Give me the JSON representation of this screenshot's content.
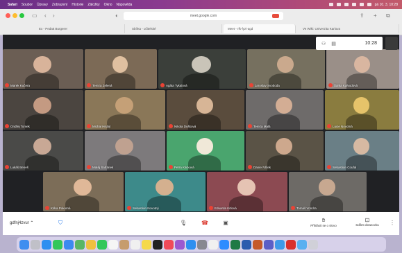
{
  "menubar": {
    "apple": "",
    "items": [
      "Safari",
      "Soubor",
      "Úpravy",
      "Zobrazení",
      "Historie",
      "Záložky",
      "Okno",
      "Nápověda"
    ],
    "clock": "pá 10. 3. 10:28"
  },
  "browser": {
    "url": "meet.google.com",
    "tabs": [
      {
        "label": "Ex - Pedatt Burgerer"
      },
      {
        "label": "Sbírka - učitelské"
      },
      {
        "label": "Meet - rfk-fyzi-agd"
      },
      {
        "label": "Ve Wiki: Univerzita Karlova"
      }
    ]
  },
  "meet": {
    "time": "10:28",
    "participant_icon": "people-icon",
    "chat_icon": "chat-icon",
    "participants": [
      {
        "name": "Marek Kučera",
        "colors": [
          "#6b5e54",
          "#d8b39a"
        ]
      },
      {
        "name": "Tereza Zelená",
        "colors": [
          "#7c6a56",
          "#e0c0a0"
        ]
      },
      {
        "name": "Agáta Tykalová",
        "colors": [
          "#3b3f3a",
          "#c9c4b8"
        ]
      },
      {
        "name": "Jaroslav Svoboda",
        "colors": [
          "#76705f",
          "#caa98d"
        ]
      },
      {
        "name": "Šárka Kalvodová",
        "colors": [
          "#9a8f88",
          "#d9b6a0"
        ]
      },
      {
        "name": "Ondřej Tomek",
        "colors": [
          "#4b4540",
          "#c49a82"
        ]
      },
      {
        "name": "Michal Hrubý",
        "colors": [
          "#8a7758",
          "#c5a077"
        ]
      },
      {
        "name": "Nikola Dušková",
        "colors": [
          "#5a4c3d",
          "#d7b596"
        ]
      },
      {
        "name": "Tereza Malá",
        "colors": [
          "#6e6b6a",
          "#d3ad94"
        ]
      },
      {
        "name": "Lucie Novotná",
        "colors": [
          "#8a7c3f",
          "#e6c36a"
        ]
      },
      {
        "name": "Lukáš Beneš",
        "colors": [
          "#4a4a48",
          "#c8a895"
        ]
      },
      {
        "name": "Matěj Šafránek",
        "colors": [
          "#7d7a7c",
          "#bfa190"
        ]
      },
      {
        "name": "Petra Klicková",
        "colors": [
          "#4aa56e",
          "#f0e8d8"
        ]
      },
      {
        "name": "Daniel Vlček",
        "colors": [
          "#5a5346",
          "#cda88d"
        ]
      },
      {
        "name": "Sebastián Coufal",
        "colors": [
          "#6a7f86",
          "#d6b9a2"
        ]
      },
      {
        "name": "Klára Pokorná",
        "colors": [
          "#7c6d58",
          "#e0b898"
        ]
      },
      {
        "name": "Sebastián Novotný",
        "colors": [
          "#3d8a8a",
          "#d4b08f"
        ]
      },
      {
        "name": "Eduarda Kitlová",
        "colors": [
          "#8c4a52",
          "#e5c3b3"
        ]
      },
      {
        "name": "Tomáš Vondra",
        "colors": [
          "#6d6a66",
          "#c7a890"
        ]
      }
    ]
  },
  "bottombar": {
    "meeting_code": "gdfnj4zvur",
    "raise_hand": "Přihlásit se o slovo",
    "share": "Sdílet obrazovku"
  },
  "dock": {
    "apps": [
      "finder-icon",
      "launchpad-icon",
      "safari-icon",
      "messages-icon",
      "mail-icon",
      "maps-icon",
      "photos-icon",
      "facetime-icon",
      "calendar-icon",
      "contacts-icon",
      "reminders-icon",
      "notes-icon",
      "tv-icon",
      "music-icon",
      "podcasts-icon",
      "appstore-icon",
      "settings-icon",
      "chrome-icon",
      "zoom-icon",
      "excel-icon",
      "word-icon",
      "powerpoint-icon",
      "teams-icon",
      "preview-icon",
      "acrobat-icon",
      "folder-icon",
      "trash-icon"
    ],
    "colors": [
      "#3f8ef0",
      "#c0c0c8",
      "#2f8ff0",
      "#33c75a",
      "#3c8af0",
      "#5ab665",
      "#f0c040",
      "#33c75a",
      "#f5f5f5",
      "#c69c6d",
      "#f0f0f0",
      "#f5d94a",
      "#222222",
      "#f04a5a",
      "#9b59d0",
      "#2f8ff0",
      "#888890",
      "#f0f0f0",
      "#2d8cff",
      "#1e7a45",
      "#2b5cae",
      "#c55a2b",
      "#5b5fc7",
      "#3f9ae8",
      "#d9302c",
      "#5ab0f0",
      "#d0d0d8"
    ]
  }
}
